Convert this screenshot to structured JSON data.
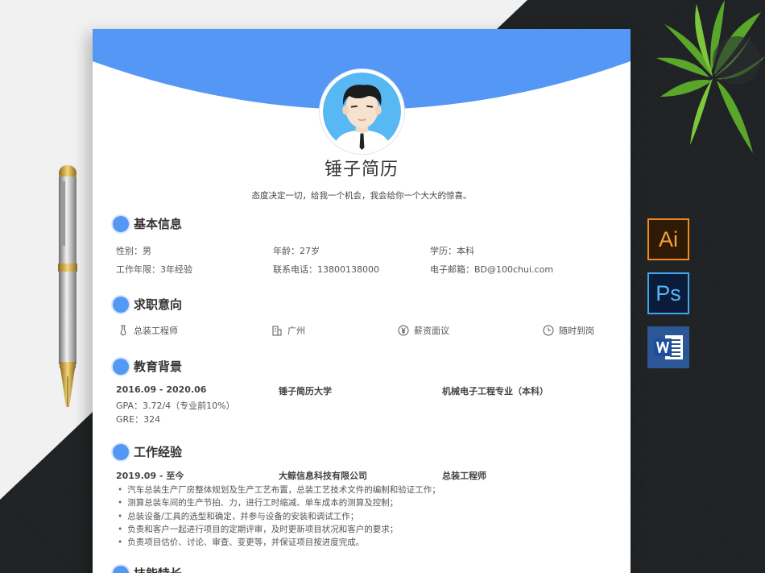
{
  "resume": {
    "title": "锤子简历",
    "motto": "态度决定一切，给我一个机会，我会给你一个大大的惊喜。",
    "sections": {
      "basic": "基本信息",
      "intent": "求职意向",
      "education": "教育背景",
      "work": "工作经验",
      "skills": "技能特长"
    },
    "basic": {
      "gender": "性别：男",
      "age": "年龄：27岁",
      "degree": "学历：本科",
      "years": "工作年限：3年经验",
      "phone": "联系电话：13800138000",
      "email": "电子邮箱：BD@100chui.com"
    },
    "intent": {
      "position": "总装工程师",
      "city": "广州",
      "salary": "薪资面议",
      "availability": "随时到岗"
    },
    "education": {
      "period": "2016.09 - 2020.06",
      "school": "锤子简历大学",
      "major": "机械电子工程专业（本科）",
      "gpa": "GPA：3.72/4（专业前10%）",
      "gre": "GRE：324"
    },
    "work": {
      "period": "2019.09 - 至今",
      "company": "大鲸信息科技有限公司",
      "role": "总装工程师",
      "duties": [
        "汽车总装生产厂房整体规划及生产工艺布置，总装工艺技术文件的编制和验证工作；",
        "测算总装车间的生产节拍、力，进行工时缩减、单车成本的测算及控制；",
        "总装设备/工具的选型和确定，并参与设备的安装和调试工作；",
        "负责和客户一起进行项目的定期评审，及时更新项目状况和客户的要求；",
        "负责项目估价、讨论、审查、变更等，并保证项目按进度完成。"
      ]
    }
  },
  "apps": {
    "ai": "Ai",
    "ps": "Ps"
  },
  "colors": {
    "accent": "#5497f5",
    "background_dark": "#1f2224"
  }
}
